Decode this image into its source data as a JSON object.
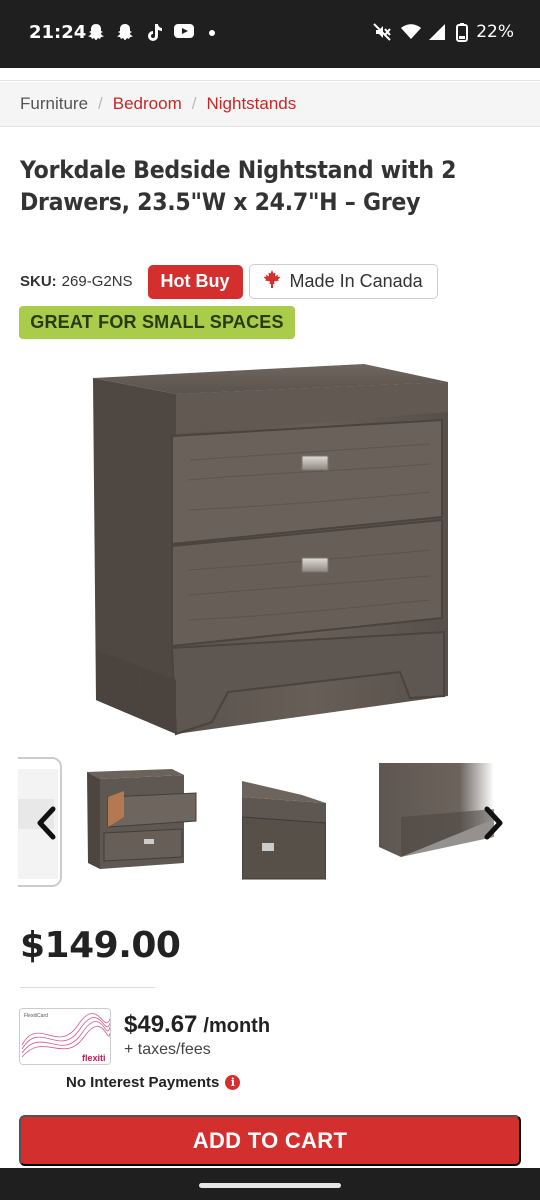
{
  "status_bar": {
    "time": "21:24",
    "battery": "22%",
    "left_icons": [
      "snapchat-icon",
      "snapchat-icon",
      "tiktok-icon",
      "youtube-icon",
      "dot-icon"
    ],
    "right_icons": [
      "mute-icon",
      "wifi-icon",
      "signal-icon",
      "battery-icon"
    ]
  },
  "breadcrumb": {
    "items": [
      "Furniture",
      "Bedroom",
      "Nightstands"
    ],
    "separator": "/"
  },
  "product": {
    "title": "Yorkdale Bedside Nightstand with 2 Drawers, 23.5\"W x 24.7\"H – Grey",
    "sku_label": "SKU:",
    "sku_value": "269-G2NS",
    "hot_buy": "Hot Buy",
    "made_in_canada": "Made In Canada",
    "feature_tag": "GREAT FOR SMALL SPACES",
    "price": "$149.00"
  },
  "financing": {
    "card_brand": "flexiti",
    "card_label": "FlexitiCard",
    "monthly_amount": "$49.67",
    "monthly_unit": "/month",
    "taxes": "+ taxes/fees",
    "no_interest": "No Interest Payments"
  },
  "gallery": {
    "prev_icon": "chevron-left-icon",
    "next_icon": "chevron-right-icon",
    "thumbnails": [
      "white-nightstand-partial",
      "nightstand-drawer-open",
      "nightstand-corner-detail",
      "nightstand-side-detail"
    ]
  },
  "cta": {
    "add_to_cart": "ADD TO CART"
  },
  "colors": {
    "brand_red": "#d32f2f",
    "tag_green": "#a9cc4a",
    "wood_grey": "#5b534d"
  }
}
